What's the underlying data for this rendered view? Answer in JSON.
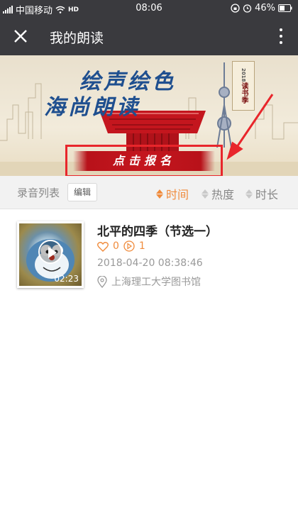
{
  "status_bar": {
    "carrier": "中国移动",
    "hd": "HD",
    "time": "08:06",
    "battery": "46%"
  },
  "header": {
    "title": "我的朗读"
  },
  "banner": {
    "line1": "绘声绘色",
    "line2": "海尚朗读",
    "scroll_year": "2018",
    "scroll_text": "读书季",
    "signup_label": "点击报名",
    "highlight_color": "#e8262b"
  },
  "toolbar": {
    "list_label": "录音列表",
    "edit_label": "编辑",
    "sort_options": [
      {
        "label": "时间",
        "active": true
      },
      {
        "label": "热度",
        "active": false
      },
      {
        "label": "时长",
        "active": false
      }
    ],
    "accent_color": "#f08b3c"
  },
  "recordings": [
    {
      "title": "北平的四季（节选一）",
      "likes": "0",
      "plays": "1",
      "duration": "02:23",
      "date": "2018-04-20 08:38:46",
      "location": "上海理工大学图书馆"
    }
  ]
}
